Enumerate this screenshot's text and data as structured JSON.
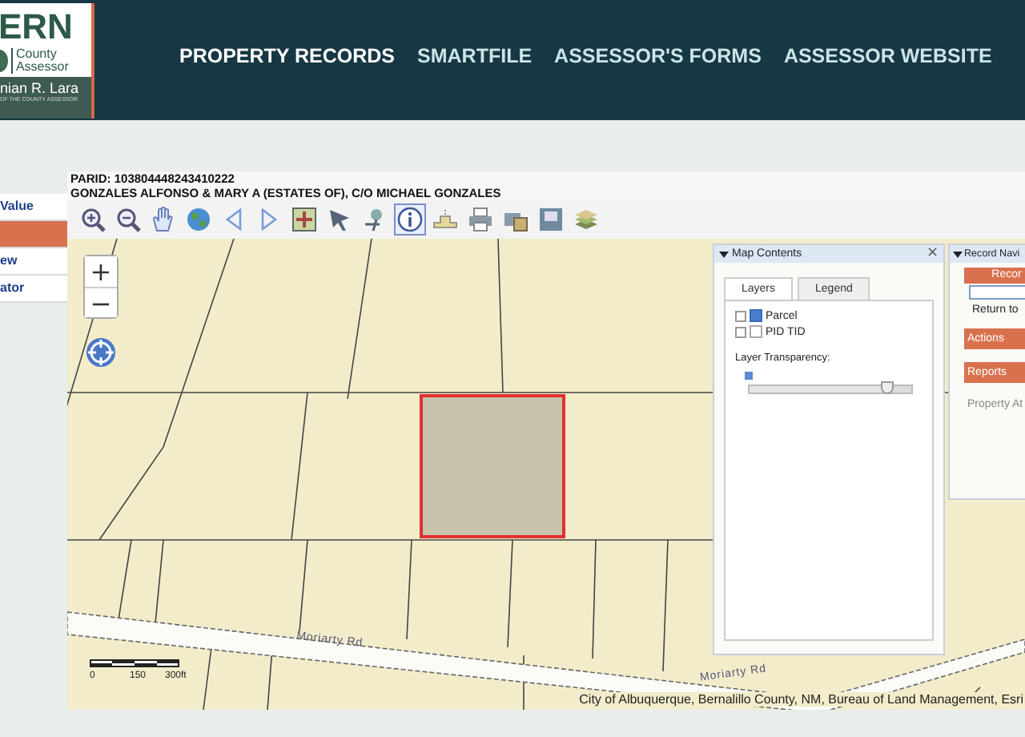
{
  "header": {
    "logo": {
      "wordmark": "ERN",
      "subtitle": "County Assessor",
      "name": "nian R. Lara",
      "tagline": "OF THE COUNTY ASSESSOR"
    },
    "nav": [
      {
        "label": "PROPERTY RECORDS",
        "selected": true
      },
      {
        "label": "SMARTFILE",
        "selected": false
      },
      {
        "label": "ASSESSOR'S FORMS",
        "selected": false
      },
      {
        "label": "ASSESSOR WEBSITE",
        "selected": false
      }
    ]
  },
  "sidebar": {
    "items": [
      {
        "label": "Value",
        "selected": false
      },
      {
        "selected": true
      },
      {
        "label": "ew",
        "selected": false
      },
      {
        "label": "ator",
        "selected": false
      }
    ]
  },
  "parcel": {
    "parid": "PARID: 103804448243410222",
    "owner": "GONZALES ALFONSO & MARY A (ESTATES OF), C/O MICHAEL GONZALES"
  },
  "toolbar": [
    {
      "kind": "zoom-in",
      "selected": false
    },
    {
      "kind": "zoom-out",
      "selected": false
    },
    {
      "kind": "pan",
      "selected": false
    },
    {
      "kind": "globe",
      "selected": false
    },
    {
      "kind": "back",
      "selected": false
    },
    {
      "kind": "forward",
      "selected": false
    },
    {
      "kind": "map",
      "selected": false
    },
    {
      "kind": "select",
      "selected": false
    },
    {
      "kind": "pin",
      "selected": false
    },
    {
      "kind": "identify",
      "selected": true
    },
    {
      "kind": "measure",
      "selected": false
    },
    {
      "kind": "print",
      "selected": false
    },
    {
      "kind": "print-map",
      "selected": false
    },
    {
      "kind": "save",
      "selected": false
    },
    {
      "kind": "layers",
      "selected": false
    }
  ],
  "map": {
    "zoom_in": "+",
    "zoom_out": "−",
    "scale": [
      "0",
      "150",
      "300ft"
    ],
    "roads": [
      "Moriarty Rd",
      "Moriarty Rd"
    ],
    "attribution": "City of Albuquerque, Bernalillo County, NM, Bureau of Land Management, Esri"
  },
  "map_contents": {
    "title": "Map Contents",
    "close": "×",
    "tabs": [
      {
        "label": "Layers",
        "selected": true
      },
      {
        "label": "Legend",
        "selected": false
      }
    ],
    "layers": [
      {
        "label": "Parcel",
        "checked": true
      },
      {
        "label": "PID TID",
        "checked": false
      }
    ],
    "transparency": {
      "label": "Layer Transparency:",
      "level": 0.85
    }
  },
  "record_nav": {
    "title": "Record Navi",
    "record": "Recor",
    "return": "Return to",
    "sections": [
      "Actions",
      "Reports"
    ],
    "link": "Property At"
  }
}
